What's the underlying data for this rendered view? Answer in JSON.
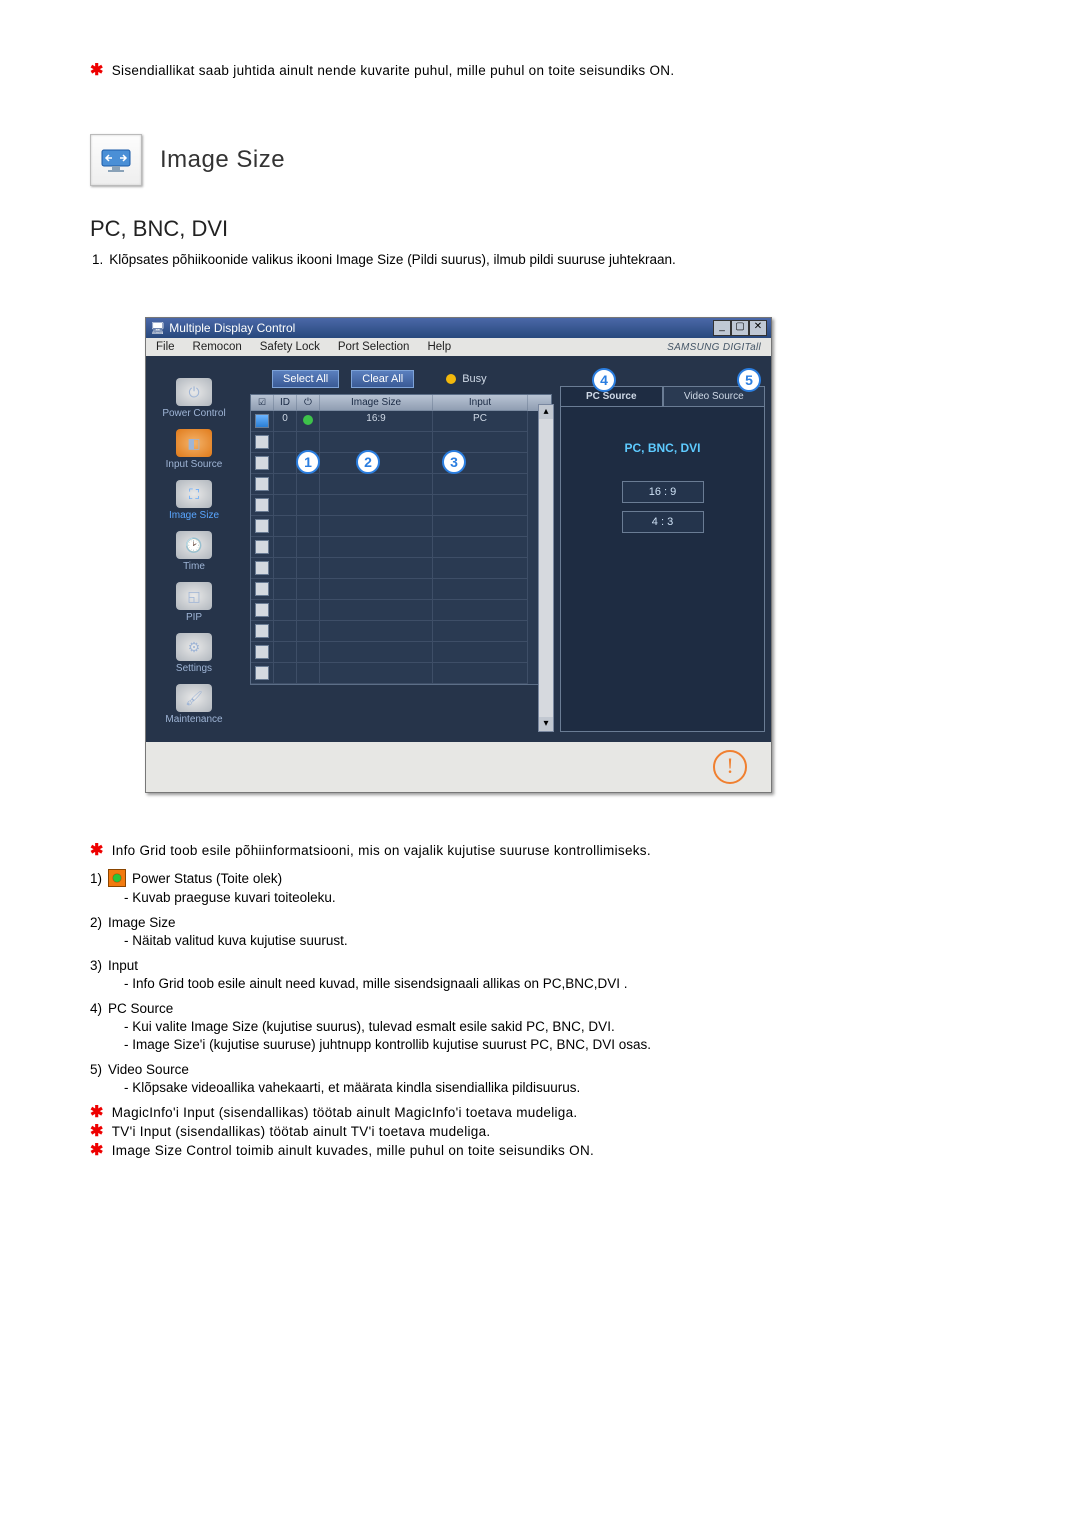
{
  "top_note": "Sisendiallikat saab juhtida ainult nende kuvarite puhul, mille puhul on toite seisundiks ON.",
  "section_title": "Image Size",
  "subhead": "PC, BNC, DVI",
  "intro_num": "1.",
  "intro_text": "Klõpsates põhiikoonide valikus ikooni Image Size (Pildi suurus), ilmub pildi suuruse juhtekraan.",
  "app": {
    "title": "Multiple Display Control",
    "menu": {
      "file": "File",
      "remocon": "Remocon",
      "safety": "Safety Lock",
      "port": "Port Selection",
      "help": "Help"
    },
    "brand": "SAMSUNG DIGITall",
    "toolbar": {
      "select_all": "Select All",
      "clear_all": "Clear All",
      "busy": "Busy"
    },
    "sidebar": {
      "power": "Power Control",
      "input": "Input Source",
      "image": "Image Size",
      "time": "Time",
      "pip": "PIP",
      "settings": "Settings",
      "maint": "Maintenance"
    },
    "grid": {
      "cols": {
        "id": "ID",
        "imgsize": "Image Size",
        "input": "Input"
      },
      "row0": {
        "id": "0",
        "imgsize": "16:9",
        "input": "PC"
      }
    },
    "tabs": {
      "pc": "PC Source",
      "video": "Video Source"
    },
    "right_label": "PC, BNC, DVI",
    "btn169": "16 : 9",
    "btn43": "4 : 3"
  },
  "callouts": {
    "c1": "1",
    "c2": "2",
    "c3": "3",
    "c4": "4",
    "c5": "5"
  },
  "exp_intro": "Info Grid toob esile põhiinformatsiooni, mis on vajalik kujutise suuruse kontrollimiseks.",
  "exp": {
    "i1": {
      "num": "1)",
      "title": "Power Status (Toite olek)",
      "a": "Kuvab praeguse kuvari toiteoleku."
    },
    "i2": {
      "num": "2)",
      "title": "Image Size",
      "a": "Näitab valitud kuva kujutise suurust."
    },
    "i3": {
      "num": "3)",
      "title": "Input",
      "a": "Info Grid toob esile ainult need kuvad, mille sisendsignaali allikas on PC,BNC,DVI ."
    },
    "i4": {
      "num": "4)",
      "title": "PC Source",
      "a": "Kui valite Image Size (kujutise suurus), tulevad esmalt esile sakid PC, BNC, DVI.",
      "b": "Image Size'i (kujutise suuruse) juhtnupp kontrollib kujutise suurust PC, BNC, DVI osas."
    },
    "i5": {
      "num": "5)",
      "title": "Video Source",
      "a": "Klõpsake videoallika vahekaarti, et määrata kindla sisendiallika pildisuurus."
    }
  },
  "foot": {
    "a": "MagicInfo'i Input (sisendallikas) töötab ainult MagicInfo'i toetava mudeliga.",
    "b": "TV'i Input (sisendallikas) töötab ainult TV'i toetava mudeliga.",
    "c": "Image Size Control toimib ainult kuvades, mille puhul on toite seisundiks ON."
  }
}
